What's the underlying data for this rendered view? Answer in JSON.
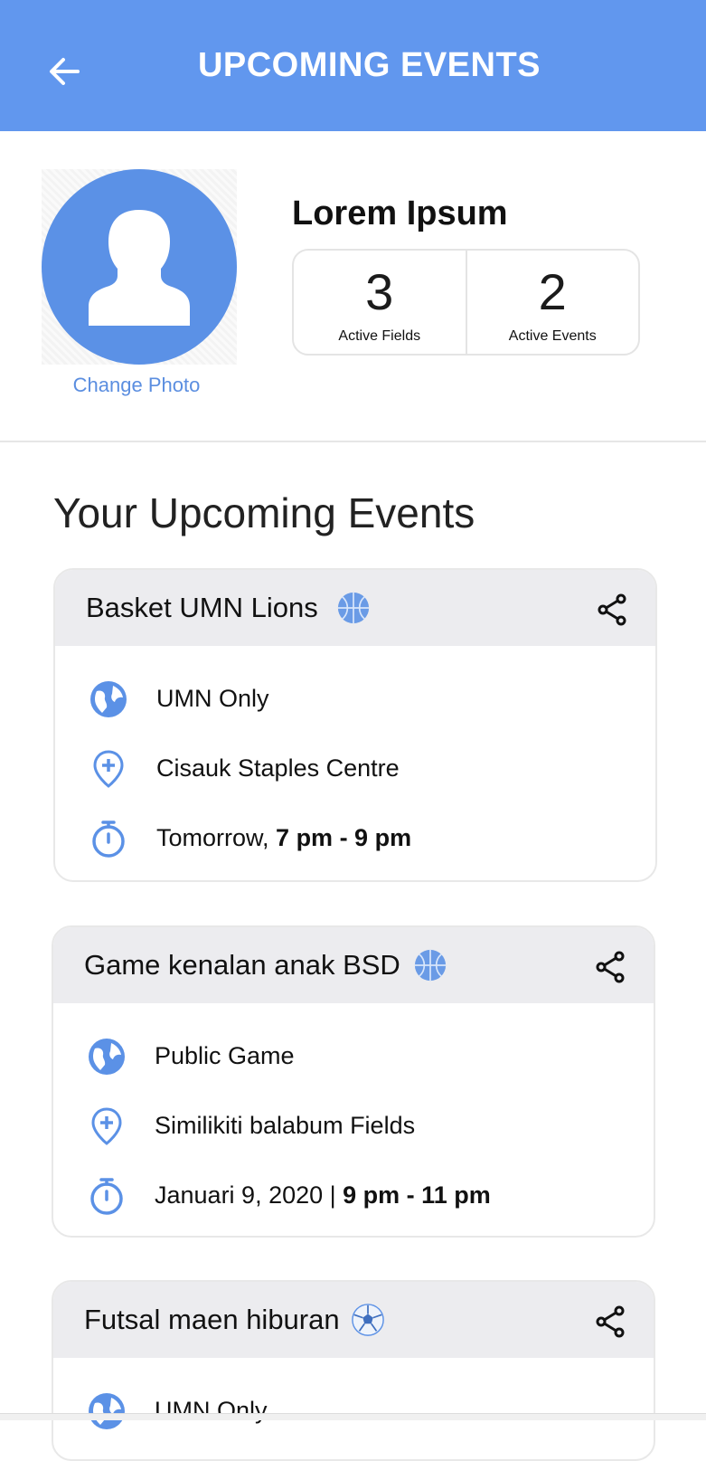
{
  "header": {
    "title": "UPCOMING EVENTS"
  },
  "profile": {
    "name": "Lorem Ipsum",
    "change_photo": "Change Photo",
    "stats": [
      {
        "value": "3",
        "label": "Active Fields"
      },
      {
        "value": "2",
        "label": "Active Events"
      }
    ]
  },
  "section_title": "Your Upcoming Events",
  "events": [
    {
      "title": "Basket UMN Lions",
      "sport_icon": "basketball-icon",
      "access": "UMN Only",
      "location": "Cisauk Staples Centre",
      "date": "Tomorrow, ",
      "time": "7 pm - 9 pm"
    },
    {
      "title": "Game kenalan anak BSD",
      "sport_icon": "basketball-icon",
      "access": "Public Game",
      "location": "Similikiti balabum Fields",
      "date": "Januari 9, 2020 | ",
      "time": "9 pm - 11 pm"
    },
    {
      "title": "Futsal maen hiburan",
      "sport_icon": "soccer-ball-icon",
      "access": "UMN Only"
    }
  ],
  "colors": {
    "primary": "#6197ee",
    "accent": "#5b8ee0",
    "card_header": "#ececef"
  }
}
